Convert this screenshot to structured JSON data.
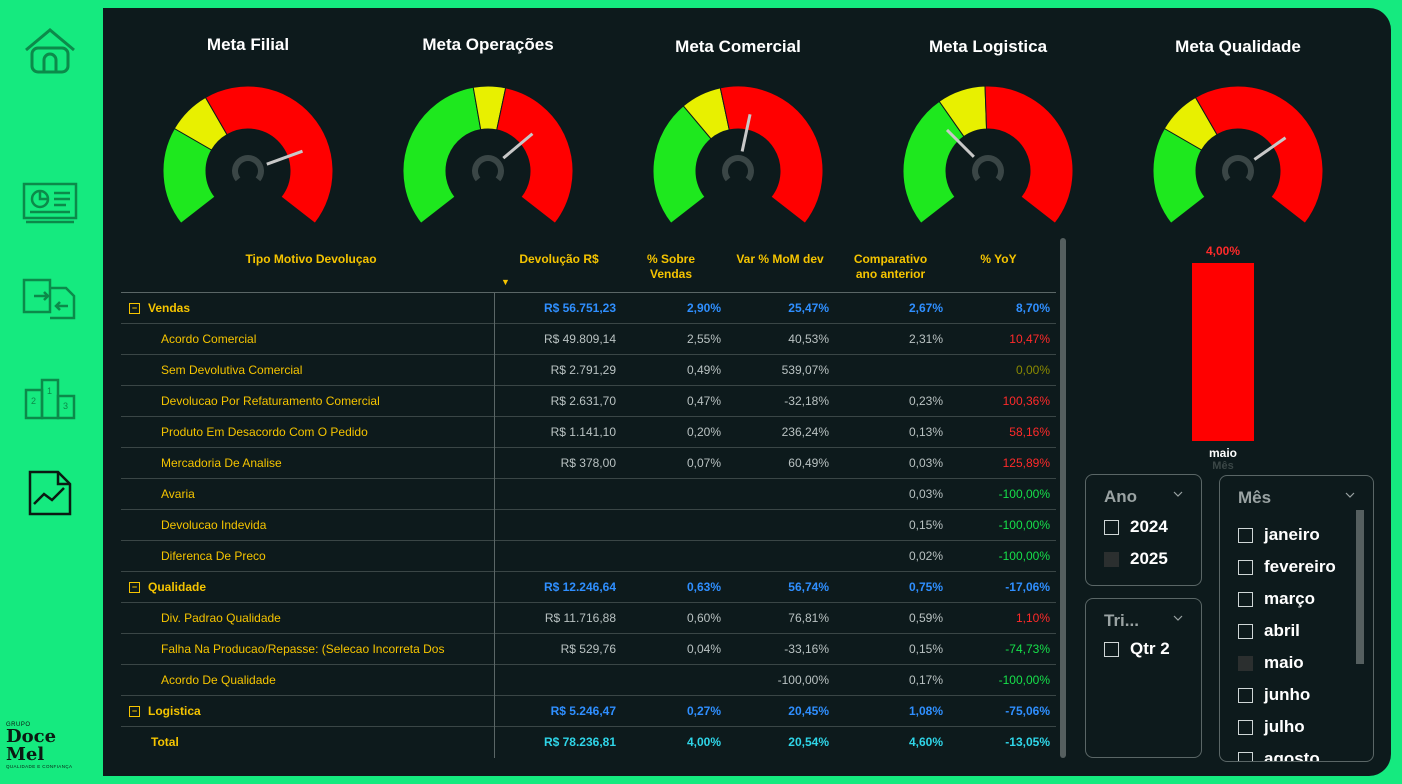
{
  "gauges": [
    {
      "title": "Meta Filial",
      "needle_angle": 70
    },
    {
      "title": "Meta Operações",
      "needle_angle": 50
    },
    {
      "title": "Meta Comercial",
      "needle_angle": 12
    },
    {
      "title": "Meta Logistica",
      "needle_angle": -45
    },
    {
      "title": "Meta Qualidade",
      "needle_angle": 55
    }
  ],
  "table": {
    "headers": {
      "tipo": "Tipo Motivo Devoluçao",
      "devolucao": "Devolução R$",
      "sobre_vendas": "% Sobre Vendas",
      "mom": "Var % MoM dev",
      "comparativo": "Comparativo ano anterior",
      "yoy": "% YoY"
    },
    "rows": [
      {
        "type": "group",
        "toggle": "⊟",
        "name": "Vendas",
        "dev": "R$ 56.751,23",
        "sv": "2,90%",
        "mom": "25,47%",
        "comp": "2,67%",
        "yoy": "8,70%",
        "yoy_class": ""
      },
      {
        "type": "child",
        "name": "Acordo Comercial",
        "dev": "R$ 49.809,14",
        "sv": "2,55%",
        "mom": "40,53%",
        "comp": "2,31%",
        "yoy": "10,47%",
        "yoy_class": "neg"
      },
      {
        "type": "child",
        "name": "Sem Devolutiva Comercial",
        "dev": "R$ 2.791,29",
        "sv": "0,49%",
        "mom": "539,07%",
        "comp": "",
        "yoy": "0,00%",
        "yoy_class": "olive"
      },
      {
        "type": "child",
        "name": "Devolucao Por Refaturamento Comercial",
        "dev": "R$ 2.631,70",
        "sv": "0,47%",
        "mom": "-32,18%",
        "comp": "0,23%",
        "yoy": "100,36%",
        "yoy_class": "neg"
      },
      {
        "type": "child",
        "name": "Produto Em Desacordo Com O Pedido",
        "dev": "R$ 1.141,10",
        "sv": "0,20%",
        "mom": "236,24%",
        "comp": "0,13%",
        "yoy": "58,16%",
        "yoy_class": "neg"
      },
      {
        "type": "child",
        "name": "Mercadoria De Analise",
        "dev": "R$ 378,00",
        "sv": "0,07%",
        "mom": "60,49%",
        "comp": "0,03%",
        "yoy": "125,89%",
        "yoy_class": "neg"
      },
      {
        "type": "child",
        "name": "Avaria",
        "dev": "",
        "sv": "",
        "mom": "",
        "comp": "0,03%",
        "yoy": "-100,00%",
        "yoy_class": "pos"
      },
      {
        "type": "child",
        "name": "Devolucao Indevida",
        "dev": "",
        "sv": "",
        "mom": "",
        "comp": "0,15%",
        "yoy": "-100,00%",
        "yoy_class": "pos"
      },
      {
        "type": "child",
        "name": "Diferenca De Preco",
        "dev": "",
        "sv": "",
        "mom": "",
        "comp": "0,02%",
        "yoy": "-100,00%",
        "yoy_class": "pos"
      },
      {
        "type": "group",
        "toggle": "⊟",
        "name": "Qualidade",
        "dev": "R$ 12.246,64",
        "sv": "0,63%",
        "mom": "56,74%",
        "comp": "0,75%",
        "yoy": "-17,06%",
        "yoy_class": ""
      },
      {
        "type": "child",
        "name": "Div. Padrao Qualidade",
        "dev": "R$ 11.716,88",
        "sv": "0,60%",
        "mom": "76,81%",
        "comp": "0,59%",
        "yoy": "1,10%",
        "yoy_class": "neg"
      },
      {
        "type": "child",
        "name": "Falha Na Producao/Repasse: (Selecao Incorreta Dos",
        "dev": "R$ 529,76",
        "sv": "0,04%",
        "mom": "-33,16%",
        "comp": "0,15%",
        "yoy": "-74,73%",
        "yoy_class": "pos"
      },
      {
        "type": "child",
        "name": "Acordo De Qualidade",
        "dev": "",
        "sv": "",
        "mom": "-100,00%",
        "comp": "0,17%",
        "yoy": "-100,00%",
        "yoy_class": "pos"
      },
      {
        "type": "group",
        "toggle": "⊟",
        "name": "Logistica",
        "dev": "R$ 5.246,47",
        "sv": "0,27%",
        "mom": "20,45%",
        "comp": "1,08%",
        "yoy": "-75,06%",
        "yoy_class": ""
      },
      {
        "type": "total",
        "name": "Total",
        "dev": "R$ 78.236,81",
        "sv": "4,00%",
        "mom": "20,54%",
        "comp": "4,60%",
        "yoy": "-13,05%",
        "yoy_class": ""
      }
    ]
  },
  "chart_data": {
    "type": "bar",
    "categories": [
      "maio"
    ],
    "values": [
      4.0
    ],
    "value_labels": [
      "4,00%"
    ],
    "xlabel": "Mês",
    "bar_color": "#ff0000"
  },
  "slicers": {
    "ano": {
      "title": "Ano",
      "options": [
        {
          "label": "2024",
          "selected": false
        },
        {
          "label": "2025",
          "selected": true
        }
      ]
    },
    "tri": {
      "title": "Tri...",
      "options": [
        {
          "label": "Qtr 2",
          "selected": false
        }
      ]
    },
    "mes": {
      "title": "Mês",
      "options": [
        {
          "label": "janeiro",
          "selected": false
        },
        {
          "label": "fevereiro",
          "selected": false
        },
        {
          "label": "março",
          "selected": false
        },
        {
          "label": "abril",
          "selected": false
        },
        {
          "label": "maio",
          "selected": true
        },
        {
          "label": "junho",
          "selected": false
        },
        {
          "label": "julho",
          "selected": false
        },
        {
          "label": "agosto",
          "selected": false
        }
      ]
    }
  },
  "logo": {
    "grupo": "GRUPO",
    "name": "Doce Mel",
    "tagline": "QUALIDADE E CONFIANÇA"
  },
  "nav_icons": [
    "home-icon",
    "dashboard-icon",
    "transfer-icon",
    "podium-icon",
    "trend-chart-icon"
  ]
}
